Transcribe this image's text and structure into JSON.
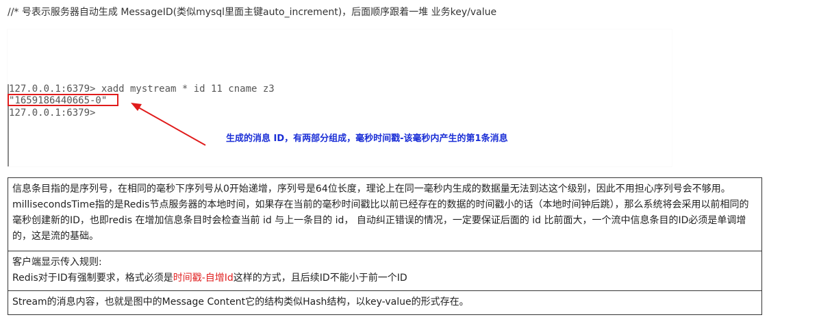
{
  "heading": "//* 号表示服务器自动生成 MessageID(类似mysql里面主键auto_increment)，后面顺序跟着一堆 业务key/value",
  "terminal": {
    "line1": "127.0.0.1:6379> xadd mystream * id 11 cname z3",
    "line2": "\"1659186440665-0\"",
    "line3": "127.0.0.1:6379>",
    "annotation": "生成的消息 ID，有两部分组成，毫秒时间戳-该毫秒内产生的第1条消息"
  },
  "notes": {
    "row1": "信息条目指的是序列号，在相同的毫秒下序列号从0开始递增，序列号是64位长度，理论上在同一毫秒内生成的数据量无法到达这个级别，因此不用担心序列号会不够用。millisecondsTime指的是Redis节点服务器的本地时间，如果存在当前的毫秒时间戳比以前已经存在的数据的时间戳小的话（本地时间钟后跳），那么系统将会采用以前相同的毫秒创建新的ID，也即redis 在增加信息条目时会检查当前 id 与上一条目的 id， 自动纠正错误的情况，一定要保证后面的 id 比前面大，一个流中信息条目的ID必须是单调增的，这是流的基础。",
    "row2_line1": "客户端显示传入规则:",
    "row2_line2_pre": "Redis对于ID有强制要求，格式必须是",
    "row2_line2_red": "时间戳-自增Id",
    "row2_line2_post": "这样的方式，且后续ID不能小于前一个ID",
    "row3": "Stream的消息内容，也就是图中的Message Content它的结构类似Hash结构，以key-value的形式存在。"
  },
  "colors": {
    "highlight_red": "#e01b1b",
    "annotation_blue": "#1a2ed6"
  }
}
